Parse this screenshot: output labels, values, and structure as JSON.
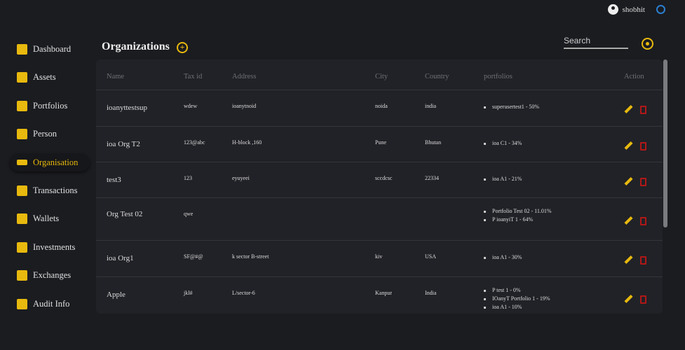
{
  "user": {
    "name": "shobhit"
  },
  "sidebar": {
    "items": [
      {
        "label": "Dashboard"
      },
      {
        "label": "Assets"
      },
      {
        "label": "Portfolios"
      },
      {
        "label": "Person"
      },
      {
        "label": "Organisation",
        "active": true
      },
      {
        "label": "Transactions"
      },
      {
        "label": "Wallets"
      },
      {
        "label": "Investments"
      },
      {
        "label": "Exchanges"
      },
      {
        "label": "Audit Info"
      }
    ]
  },
  "page": {
    "title": "Organizations",
    "search_placeholder": "Search"
  },
  "table": {
    "headers": [
      "Name",
      "Tax id",
      "Address",
      "City",
      "Country",
      "portfolios",
      "Action"
    ],
    "rows": [
      {
        "name": "ioanyttestsup",
        "tax": "wdew",
        "address": "ioanytnoid",
        "city": "noida",
        "country": "india",
        "portfolios": [
          "superusertest1 - 50%"
        ]
      },
      {
        "name": "ioa Org T2",
        "tax": "123@abc",
        "address": "H-block ,160",
        "city": "Pune",
        "country": "Bhutan",
        "portfolios": [
          "ioa C1 - 34%"
        ]
      },
      {
        "name": "test3",
        "tax": "123",
        "address": "eyuyeei",
        "city": "sccdcsc",
        "country": "22334",
        "portfolios": [
          "ioa A1 - 21%"
        ]
      },
      {
        "name": "Org Test 02",
        "tax": "qwe",
        "address": "",
        "city": "",
        "country": "",
        "portfolios": [
          "Portfolio Test 02 - 11.01%",
          "P ioanyiT 1 - 64%"
        ]
      },
      {
        "name": "ioa Org1",
        "tax": "SF@#@",
        "address": "k sector B-street",
        "city": "kiv",
        "country": "USA",
        "portfolios": [
          "ioa A1 - 30%"
        ]
      },
      {
        "name": "Apple",
        "tax": "jkl#",
        "address": "L/sector-6",
        "city": "Kanpur",
        "country": "India",
        "portfolios": [
          "P test 1 - 0%",
          "IOanyT Portfolio 1 - 19%",
          "ioa A1 - 10%"
        ]
      }
    ]
  },
  "colors": {
    "accent": "#e8b90e",
    "delete": "#b01818",
    "power": "#2a7fd0"
  }
}
